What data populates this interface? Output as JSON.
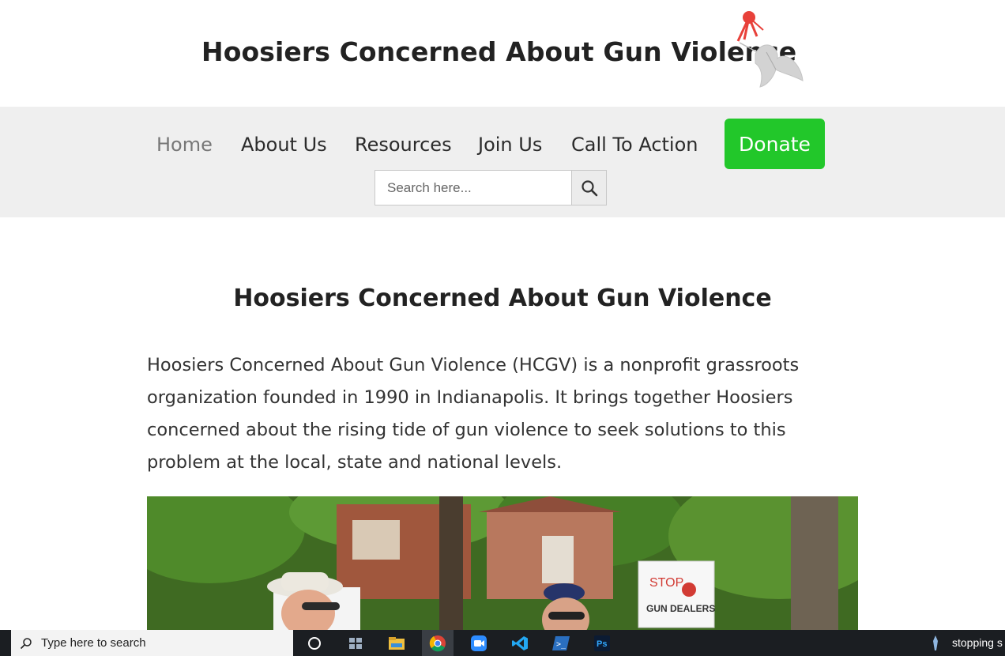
{
  "header": {
    "site_title": "Hoosiers Concerned About Gun Violence"
  },
  "nav": {
    "items": [
      {
        "label": "Home",
        "active": true
      },
      {
        "label": "About Us",
        "active": false
      },
      {
        "label": "Resources",
        "active": false
      },
      {
        "label": "Join Us",
        "active": false
      },
      {
        "label": "Call To Action",
        "active": false
      }
    ],
    "donate_label": "Donate",
    "donate_color": "#22c72a"
  },
  "search": {
    "placeholder": "Search here...",
    "icon": "search-icon"
  },
  "main": {
    "title": "Hoosiers Concerned About Gun Violence",
    "intro": "Hoosiers Concerned About Gun Violence (HCGV) is a nonprofit grassroots organization founded in 1990 in Indianapolis. It brings together Hoosiers concerned about the rising tide of gun violence to seek solutions to this problem at the local, state and national levels.",
    "photo": {
      "sign_text_1": "STOP",
      "sign_text_2": "GUN DEALERS"
    }
  },
  "taskbar": {
    "search_placeholder": "Type here to search",
    "apps": [
      "task-view-icon",
      "file-explorer-icon",
      "chrome-icon",
      "zoom-icon",
      "vscode-icon",
      "powershell-icon",
      "photoshop-icon"
    ],
    "powershell_label": ">_",
    "photoshop_label": "Ps",
    "right_text": "stopping s"
  }
}
